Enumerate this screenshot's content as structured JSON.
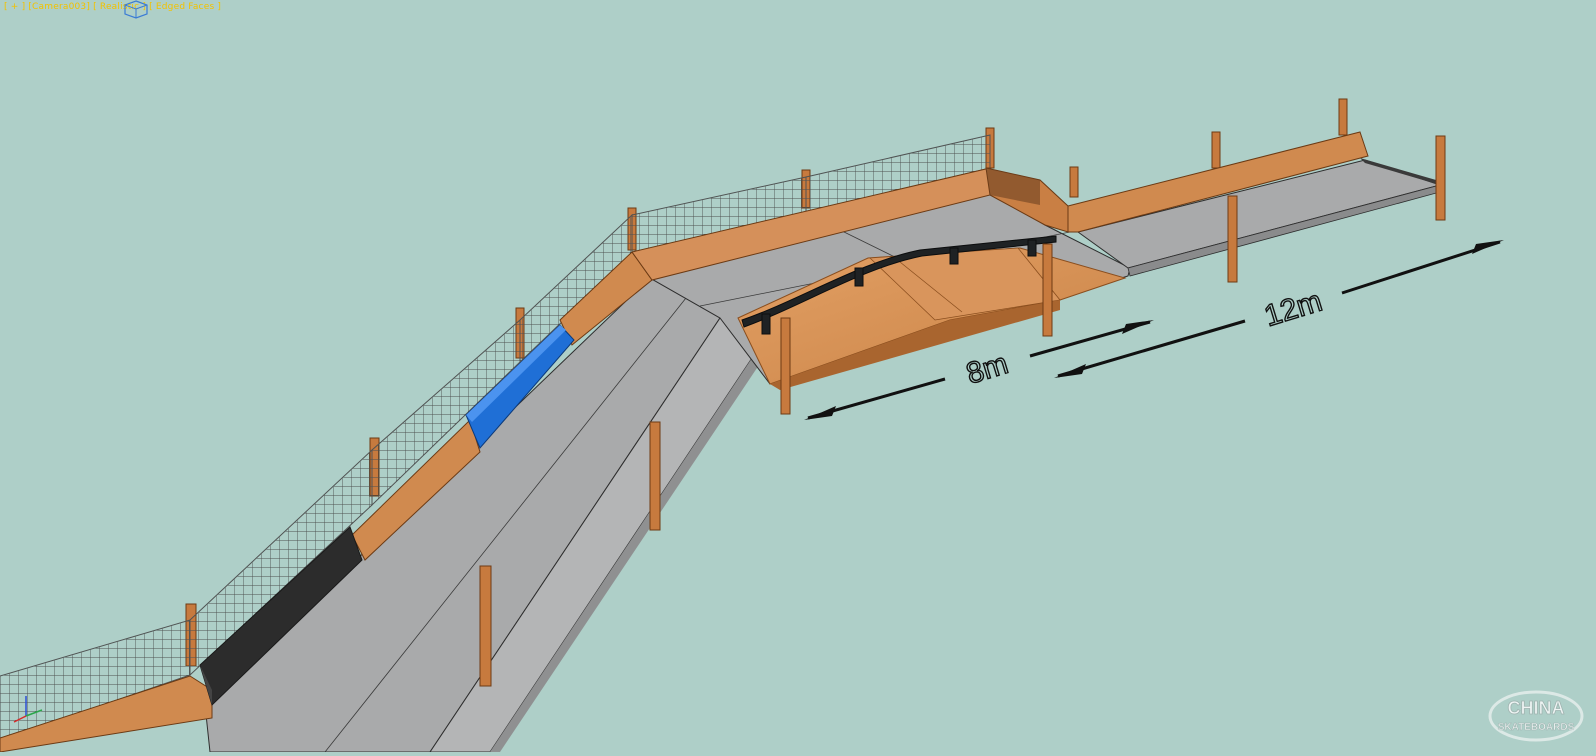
{
  "viewport": {
    "label": "[ + ] [Camera003] [ Realistic ] [ Edged Faces ]",
    "background": "#aecfc8"
  },
  "icons": {
    "viewcube": "viewcube-icon",
    "axis": "axis-gizmo-icon"
  },
  "dimensions": {
    "short_label": "8m",
    "long_label": "12m"
  },
  "watermark": {
    "line1": "CHINA",
    "line2": "SKATEBOARDS"
  },
  "colors": {
    "wood": "#d08a4f",
    "concrete": "#a9aaab",
    "net": "#4f5252",
    "rail": "#1f2224",
    "blue_box": "#1f6fd6",
    "black_box": "#2a2a2a",
    "label": "#f2c200"
  }
}
